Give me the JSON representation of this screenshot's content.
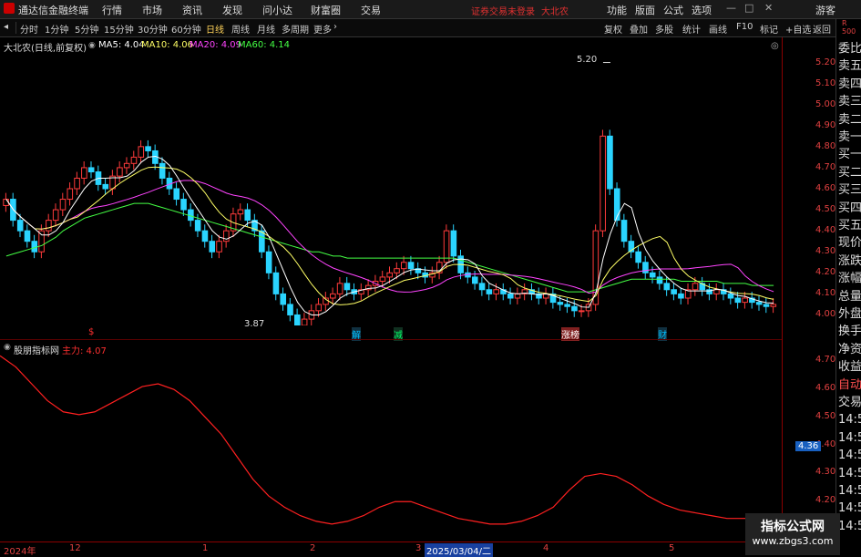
{
  "menubar": {
    "app_title": "通达信金融终端",
    "items": [
      "行情",
      "市场",
      "资讯",
      "发现",
      "问小达",
      "财富圈",
      "交易"
    ],
    "warning": "证券交易未登录",
    "stock_name": "大北农",
    "right_items": [
      "功能",
      "版面",
      "公式",
      "选项"
    ],
    "guest": "游客"
  },
  "toolbar": {
    "periods": [
      "分时",
      "1分钟",
      "5分钟",
      "15分钟",
      "30分钟",
      "60分钟",
      "日线",
      "周线",
      "月线",
      "多周期",
      "更多"
    ],
    "active_period": "日线",
    "right_items": [
      "复权",
      "叠加",
      "多股",
      "统计",
      "画线",
      "F10",
      "标记",
      "+自选",
      "返回"
    ]
  },
  "price_panel": {
    "title": "大北农(日线,前复权)",
    "ma": [
      {
        "label": "MA5: 4.04",
        "color": "#ffffff"
      },
      {
        "label": "MA10: 4.06",
        "color": "#ffff66"
      },
      {
        "label": "MA20: 4.09",
        "color": "#ff44ff"
      },
      {
        "label": "MA60: 4.14",
        "color": "#44ff44"
      }
    ],
    "high_label": "5.20",
    "low_label": "3.87",
    "events": [
      {
        "text": "$",
        "color": "#ff3030"
      },
      {
        "text": "解",
        "color": "#00c0ff"
      },
      {
        "text": "减",
        "color": "#00ff66"
      },
      {
        "text": "涨榜",
        "color": "#ffffff"
      },
      {
        "text": "财",
        "color": "#00c0ff"
      }
    ],
    "y_ticks": [
      "5.20",
      "5.10",
      "5.00",
      "4.90",
      "4.80",
      "4.70",
      "4.60",
      "4.50",
      "4.40",
      "4.30",
      "4.20",
      "4.10",
      "4.00"
    ]
  },
  "indicator_panel": {
    "title": "股朋指标网",
    "line_label": "主力: 4.07",
    "y_ticks": [
      "4.70",
      "4.60",
      "4.50",
      "4.40",
      "4.30",
      "4.20"
    ],
    "current_value": "4.36"
  },
  "x_axis": {
    "labels": [
      "2024年",
      "12",
      "1",
      "2",
      "3",
      "2025/03/04/二",
      "4",
      "5"
    ]
  },
  "right_column": {
    "items": [
      "委比",
      "卖五",
      "卖四",
      "卖三",
      "卖二",
      "卖一",
      "买一",
      "买二",
      "买三",
      "买四",
      "买五",
      "现价",
      "涨跌",
      "涨幅",
      "总量",
      "外盘",
      "换手",
      "净资",
      "收益",
      "自动",
      "交易",
      "14:5",
      "14:5",
      "14:5",
      "14:5",
      "14:5",
      "14:5",
      "14:5"
    ],
    "top_badge": "R 500"
  },
  "watermark": {
    "title": "指标公式网",
    "url": "www.zbgs3.com"
  },
  "chart_data": {
    "type": "candlestick",
    "title": "大北农(日线,前复权)",
    "ylim": [
      3.95,
      5.25
    ],
    "closes": [
      4.55,
      4.45,
      4.4,
      4.35,
      4.3,
      4.4,
      4.45,
      4.5,
      4.55,
      4.6,
      4.65,
      4.7,
      4.68,
      4.62,
      4.6,
      4.66,
      4.7,
      4.72,
      4.75,
      4.8,
      4.78,
      4.72,
      4.65,
      4.6,
      4.55,
      4.5,
      4.45,
      4.4,
      4.35,
      4.3,
      4.35,
      4.4,
      4.48,
      4.5,
      4.45,
      4.4,
      4.3,
      4.2,
      4.1,
      4.05,
      4.0,
      3.95,
      3.98,
      4.02,
      4.05,
      4.08,
      4.1,
      4.15,
      4.12,
      4.1,
      4.12,
      4.14,
      4.16,
      4.18,
      4.2,
      4.22,
      4.25,
      4.22,
      4.2,
      4.18,
      4.2,
      4.25,
      4.4,
      4.28,
      4.2,
      4.18,
      4.15,
      4.12,
      4.1,
      4.12,
      4.1,
      4.08,
      4.1,
      4.12,
      4.1,
      4.08,
      4.1,
      4.06,
      4.05,
      4.04,
      4.02,
      4.02,
      4.05,
      4.4,
      4.85,
      4.6,
      4.45,
      4.35,
      4.3,
      4.25,
      4.2,
      4.18,
      4.15,
      4.12,
      4.1,
      4.08,
      4.12,
      4.15,
      4.12,
      4.1,
      4.12,
      4.1,
      4.08,
      4.06,
      4.08,
      4.06,
      4.05,
      4.04,
      4.05
    ],
    "ma60": [
      4.28,
      4.29,
      4.3,
      4.31,
      4.32,
      4.33,
      4.35,
      4.37,
      4.4,
      4.42,
      4.44,
      4.46,
      4.47,
      4.48,
      4.49,
      4.5,
      4.51,
      4.52,
      4.53,
      4.53,
      4.53,
      4.52,
      4.51,
      4.5,
      4.49,
      4.48,
      4.47,
      4.46,
      4.45,
      4.44,
      4.43,
      4.42,
      4.41,
      4.4,
      4.39,
      4.38,
      4.37,
      4.36,
      4.35,
      4.34,
      4.33,
      4.32,
      4.31,
      4.3,
      4.3,
      4.29,
      4.28,
      4.28,
      4.27,
      4.27,
      4.27,
      4.27,
      4.27,
      4.27,
      4.27,
      4.27,
      4.27,
      4.27,
      4.27,
      4.27,
      4.27,
      4.27,
      4.27,
      4.27,
      4.26,
      4.25,
      4.24,
      4.23,
      4.22,
      4.21,
      4.2,
      4.19,
      4.18,
      4.17,
      4.16,
      4.15,
      4.14,
      4.13,
      4.12,
      4.11,
      4.11,
      4.11,
      4.11,
      4.12,
      4.13,
      4.14,
      4.15,
      4.16,
      4.17,
      4.17,
      4.17,
      4.17,
      4.17,
      4.17,
      4.17,
      4.16,
      4.16,
      4.16,
      4.16,
      4.16,
      4.16,
      4.15,
      4.15,
      4.15,
      4.15,
      4.14,
      4.14,
      4.14,
      4.14
    ],
    "indicator": [
      4.72,
      4.68,
      4.62,
      4.56,
      4.52,
      4.51,
      4.52,
      4.55,
      4.58,
      4.61,
      4.62,
      4.6,
      4.56,
      4.5,
      4.44,
      4.36,
      4.28,
      4.22,
      4.18,
      4.15,
      4.13,
      4.12,
      4.13,
      4.15,
      4.18,
      4.2,
      4.2,
      4.18,
      4.16,
      4.14,
      4.13,
      4.12,
      4.12,
      4.13,
      4.15,
      4.18,
      4.24,
      4.29,
      4.3,
      4.29,
      4.26,
      4.22,
      4.19,
      4.17,
      4.16,
      4.15,
      4.14,
      4.14,
      4.14,
      4.14
    ]
  }
}
